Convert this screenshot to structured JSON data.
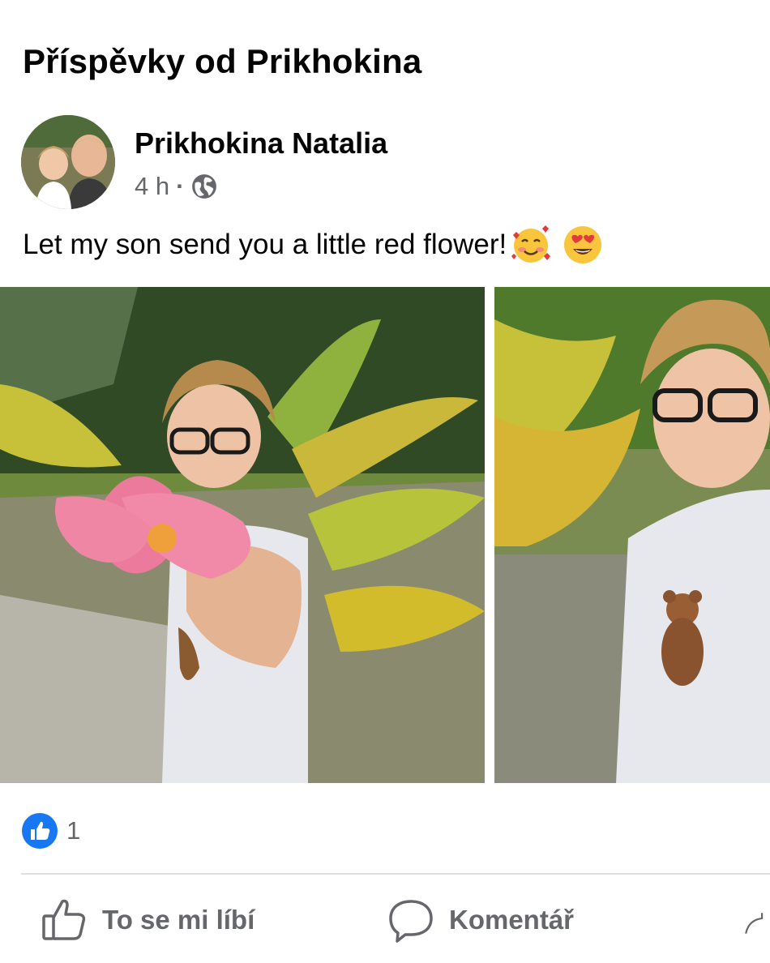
{
  "page": {
    "title": "Příspěvky od Prikhokina"
  },
  "post": {
    "author": "Prikhokina Natalia",
    "time": "4 h",
    "separator": "·",
    "privacy_icon": "globe-icon",
    "text": "Let my son send you a little red flower!",
    "emojis": [
      "smiling-face-with-hearts-emoji",
      "heart-eyes-emoji"
    ],
    "photos": [
      {
        "name": "photo-boy-holding-flower"
      },
      {
        "name": "photo-boy-smiling"
      }
    ]
  },
  "reactions": {
    "icon": "like-badge-icon",
    "count": "1"
  },
  "actions": {
    "like_label": "To se mi líbí",
    "comment_label": "Komentář",
    "share_icon": "share-icon"
  },
  "colors": {
    "brand_blue": "#1877f2",
    "text_primary": "#050505",
    "text_secondary": "#65676b",
    "divider": "#dddfe2"
  }
}
